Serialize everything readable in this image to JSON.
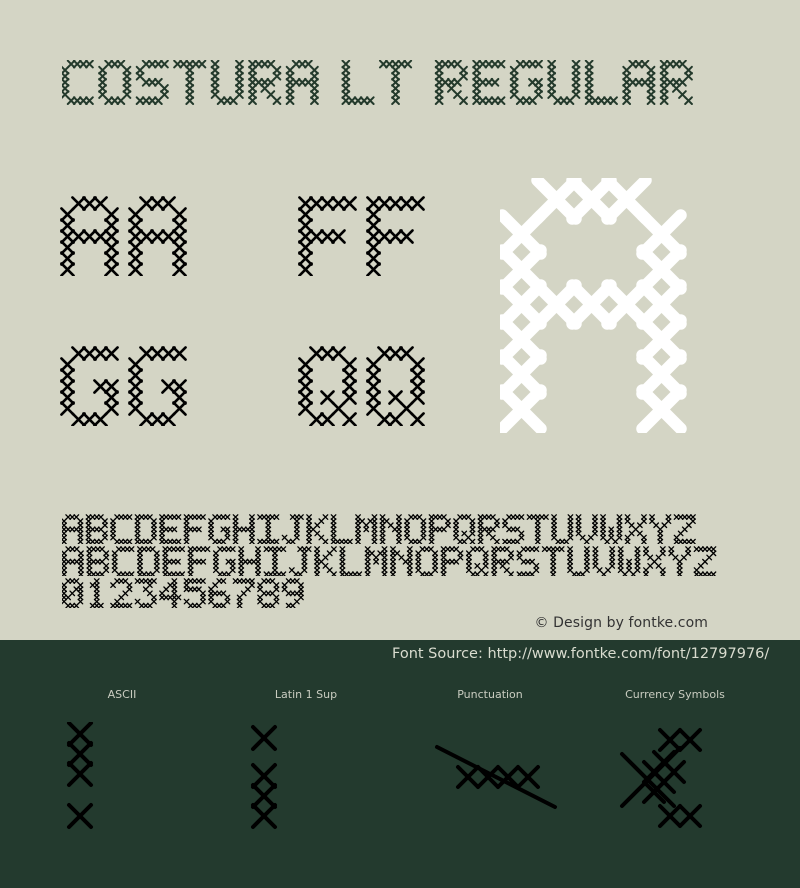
{
  "page": {
    "title": "COSTURA LT REGULAR",
    "font_name": "Costura LT Regular",
    "colors": {
      "background_light": "#d4d5c5",
      "background_dark": "#233a2e",
      "title_ink": "#243a2c",
      "sample_ink": "#000000",
      "highlight_glyph": "#ffffff"
    }
  },
  "samples": {
    "pairs": [
      {
        "label": "Aa",
        "chars": [
          "A",
          "a"
        ]
      },
      {
        "label": "Ff",
        "chars": [
          "F",
          "f"
        ]
      },
      {
        "label": "Gg",
        "chars": [
          "G",
          "g"
        ]
      },
      {
        "label": "Qq",
        "chars": [
          "Q",
          "q"
        ]
      }
    ],
    "hero_char": "a"
  },
  "alphabet": {
    "uppercase": "ABCDEFGHIJKLMNOPQRSTUVWXYZ",
    "lowercase": "abcdefghijklmnopqrstuvwxyz",
    "digits": "0123456789"
  },
  "credit": "© Design by fontke.com",
  "source": "Font Source: http://www.fontke.com/font/12797976/",
  "categories": [
    {
      "label": "ASCII",
      "glyph": "ascii"
    },
    {
      "label": "Latin 1 Sup",
      "glyph": "latin1"
    },
    {
      "label": "Punctuation",
      "glyph": "punct"
    },
    {
      "label": "Currency Symbols",
      "glyph": "currency"
    }
  ]
}
